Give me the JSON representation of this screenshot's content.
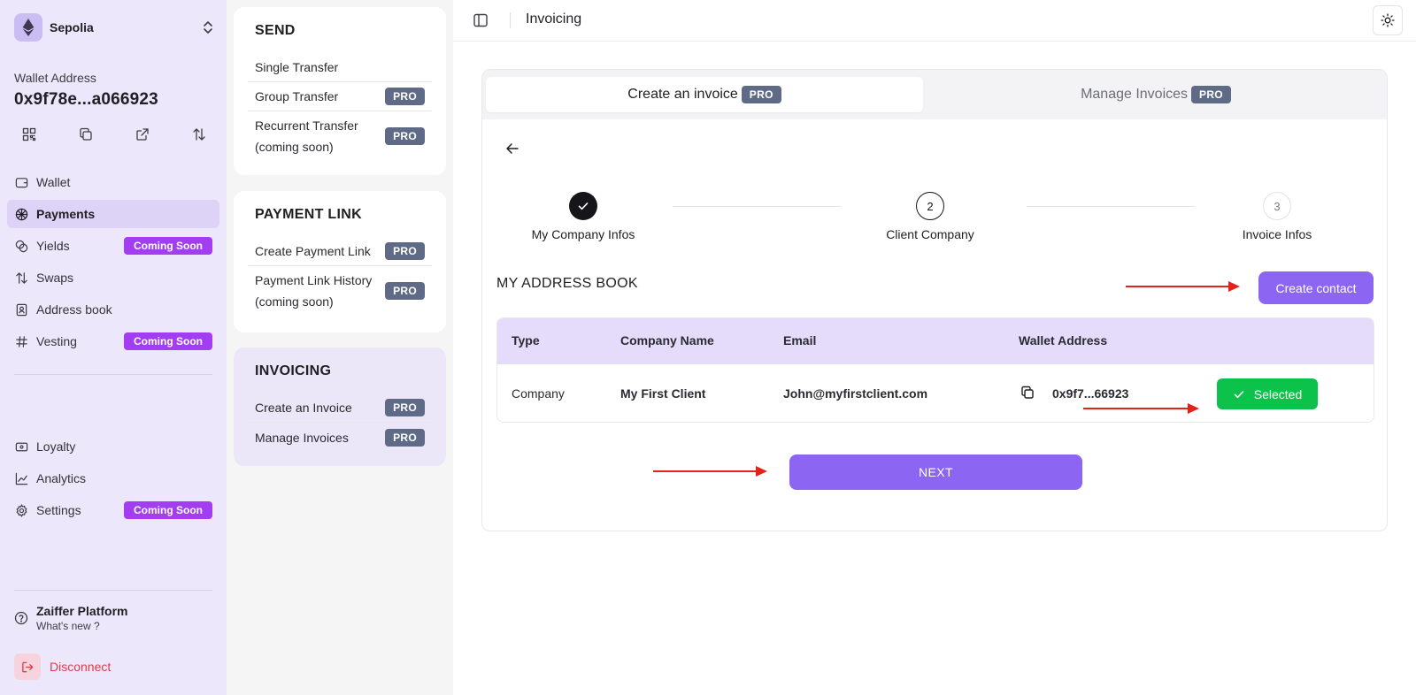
{
  "sidebar": {
    "network": "Sepolia",
    "wallet_label": "Wallet Address",
    "wallet_address": "0x9f78e...a066923",
    "nav_main": [
      {
        "label": "Wallet",
        "icon": "wallet-icon"
      },
      {
        "label": "Payments",
        "icon": "payments-icon",
        "active": true
      },
      {
        "label": "Yields",
        "icon": "coins-icon",
        "badge": "Coming Soon"
      },
      {
        "label": "Swaps",
        "icon": "swap-icon"
      },
      {
        "label": "Address book",
        "icon": "address-book-icon"
      },
      {
        "label": "Vesting",
        "icon": "hash-icon",
        "badge": "Coming Soon"
      }
    ],
    "nav_secondary": [
      {
        "label": "Loyalty",
        "icon": "ticket-icon"
      },
      {
        "label": "Analytics",
        "icon": "chart-line-icon"
      },
      {
        "label": "Settings",
        "icon": "gear-icon",
        "badge": "Coming Soon"
      }
    ],
    "platform_title": "Zaiffer Platform",
    "platform_subtitle": "What's new ?",
    "disconnect_label": "Disconnect"
  },
  "submenu": {
    "send": {
      "title": "SEND",
      "items": [
        {
          "label": "Single Transfer"
        },
        {
          "label": "Group Transfer",
          "badge": "PRO"
        },
        {
          "label": "Recurrent Transfer (coming soon)",
          "badge": "PRO"
        }
      ]
    },
    "payment_link": {
      "title": "PAYMENT LINK",
      "items": [
        {
          "label": "Create Payment Link",
          "badge": "PRO"
        },
        {
          "label": "Payment Link History (coming soon)",
          "badge": "PRO"
        }
      ]
    },
    "invoicing": {
      "title": "INVOICING",
      "items": [
        {
          "label": "Create an Invoice",
          "badge": "PRO"
        },
        {
          "label": "Manage Invoices",
          "badge": "PRO"
        }
      ]
    }
  },
  "header": {
    "title": "Invoicing"
  },
  "tabs": [
    {
      "label": "Create an invoice",
      "badge": "PRO",
      "active": true
    },
    {
      "label": "Manage Invoices",
      "badge": "PRO",
      "active": false
    }
  ],
  "stepper": {
    "steps": [
      {
        "label": "My Company Infos",
        "state": "done",
        "number": ""
      },
      {
        "label": "Client Company",
        "state": "current",
        "number": "2"
      },
      {
        "label": "Invoice Infos",
        "state": "todo",
        "number": "3"
      }
    ]
  },
  "address_book": {
    "title": "MY ADDRESS BOOK",
    "create_label": "Create contact",
    "columns": [
      "Type",
      "Company Name",
      "Email",
      "Wallet Address"
    ],
    "rows": [
      {
        "type": "Company",
        "company_name": "My First Client",
        "email": "John@myfirstclient.com",
        "wallet": "0x9f7...66923",
        "action_label": "Selected"
      }
    ]
  },
  "next_label": "NEXT",
  "colors": {
    "sidebar_bg": "#ece7fa",
    "accent_purple": "#8c66f2",
    "badge_soon": "#a33df2",
    "badge_pro": "#5f6b86",
    "selected_green": "#0cc24a",
    "danger": "#e2394d",
    "annotation_red": "#e3231b"
  }
}
